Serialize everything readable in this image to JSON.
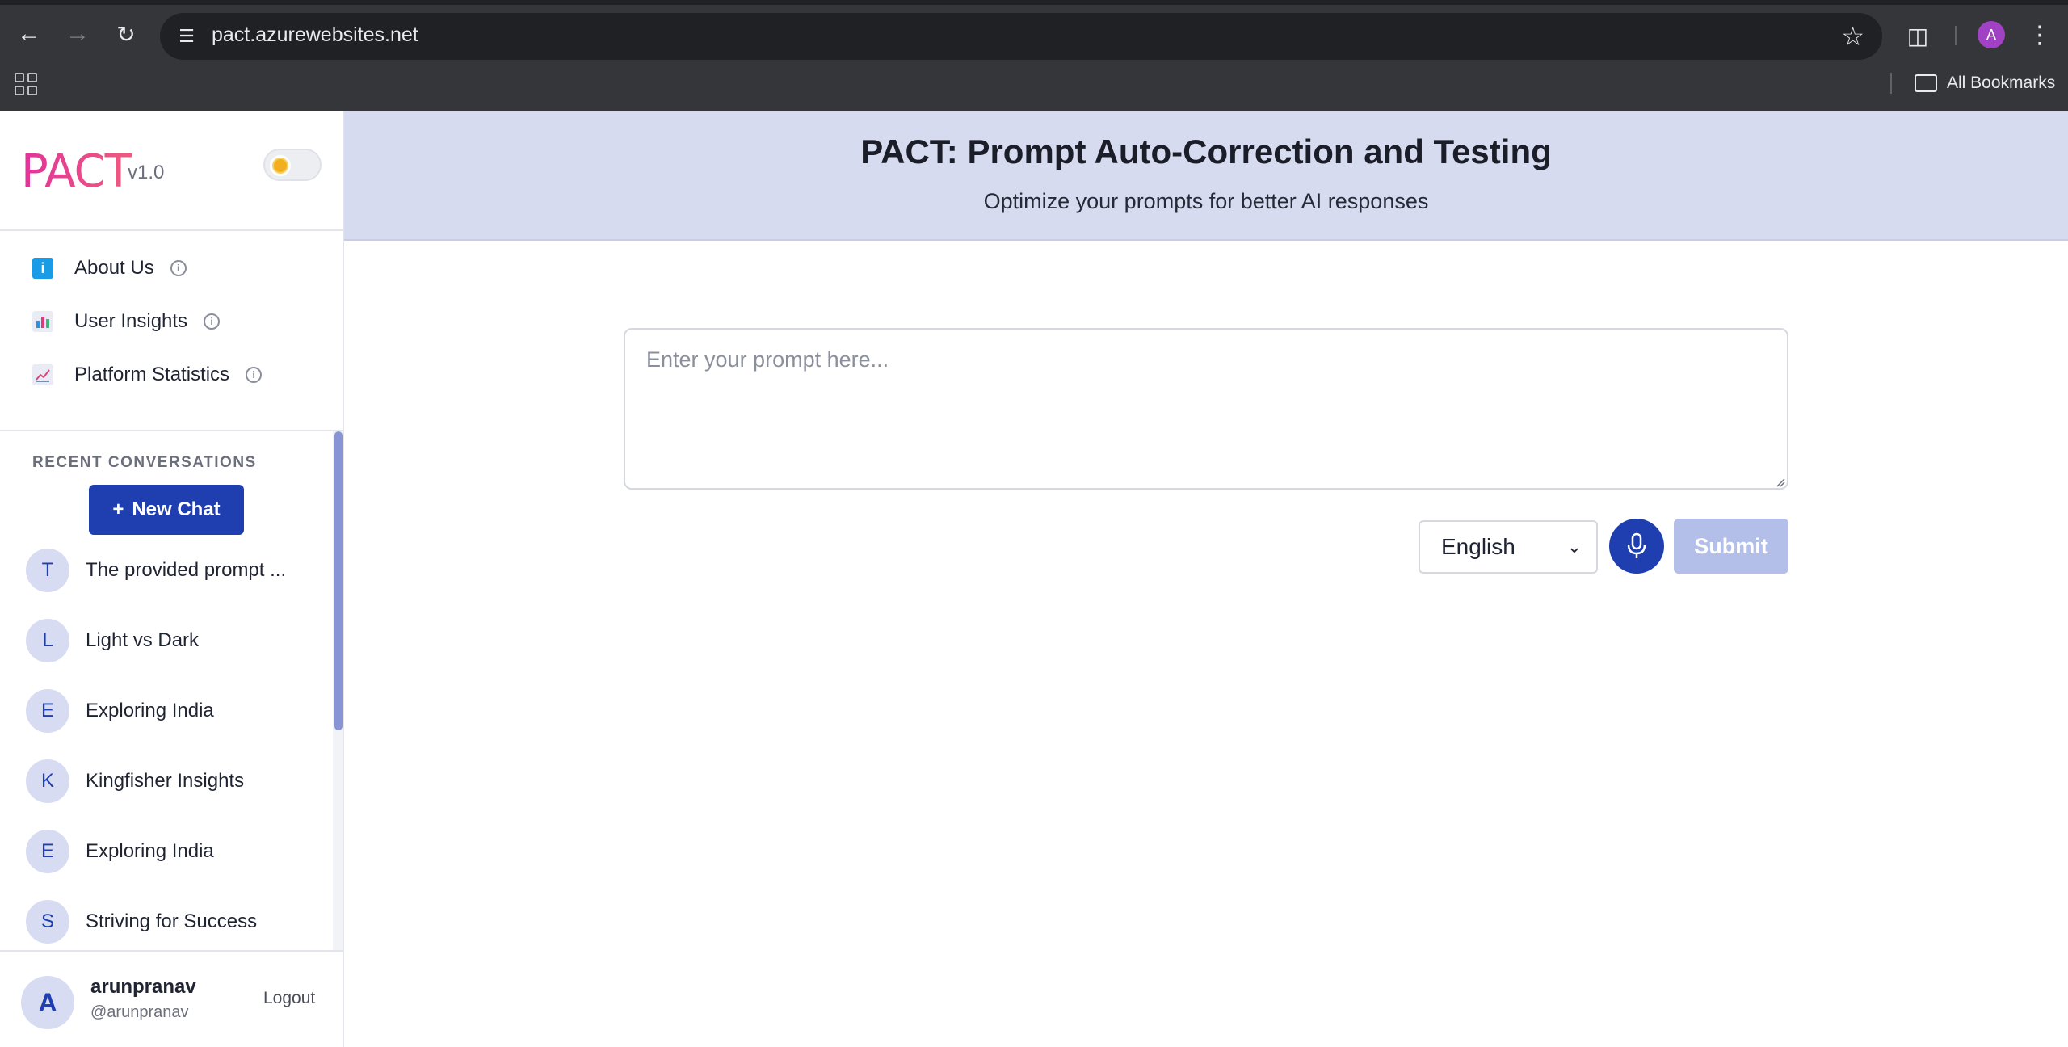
{
  "browser": {
    "url": "pact.azurewebsites.net",
    "profile_initial": "A",
    "bookmarks_label": "All Bookmarks",
    "icons": [
      "back-icon",
      "forward-icon",
      "reload-icon",
      "site-info-icon",
      "star-icon",
      "extensions-icon",
      "menu-icon",
      "apps-icon",
      "folder-icon"
    ]
  },
  "sidebar": {
    "logo": "PACT",
    "version": "v1.0",
    "nav": [
      {
        "label": "About Us",
        "icon": "info-square-icon"
      },
      {
        "label": "User Insights",
        "icon": "bar-chart-icon"
      },
      {
        "label": "Platform Statistics",
        "icon": "line-chart-icon"
      }
    ],
    "recent_header": "RECENT CONVERSATIONS",
    "new_chat_label": "New Chat",
    "new_chat_plus": "+",
    "conversations": [
      {
        "initial": "T",
        "title": "The provided prompt ..."
      },
      {
        "initial": "L",
        "title": "Light vs Dark"
      },
      {
        "initial": "E",
        "title": "Exploring India"
      },
      {
        "initial": "K",
        "title": "Kingfisher Insights"
      },
      {
        "initial": "E",
        "title": "Exploring India"
      },
      {
        "initial": "S",
        "title": "Striving for Success"
      }
    ],
    "user": {
      "initial": "A",
      "name": "arunpranav",
      "handle": "@arunpranav",
      "logout_label": "Logout"
    }
  },
  "main": {
    "title": "PACT: Prompt Auto-Correction and Testing",
    "subtitle": "Optimize your prompts for better AI responses",
    "prompt_placeholder": "Enter your prompt here...",
    "language": "English",
    "submit_label": "Submit"
  },
  "colors": {
    "accent": "#1f3fb0",
    "hero_bg": "#d6dbf0",
    "logo": "#e0349a",
    "submit_disabled": "#b3bfe8"
  }
}
